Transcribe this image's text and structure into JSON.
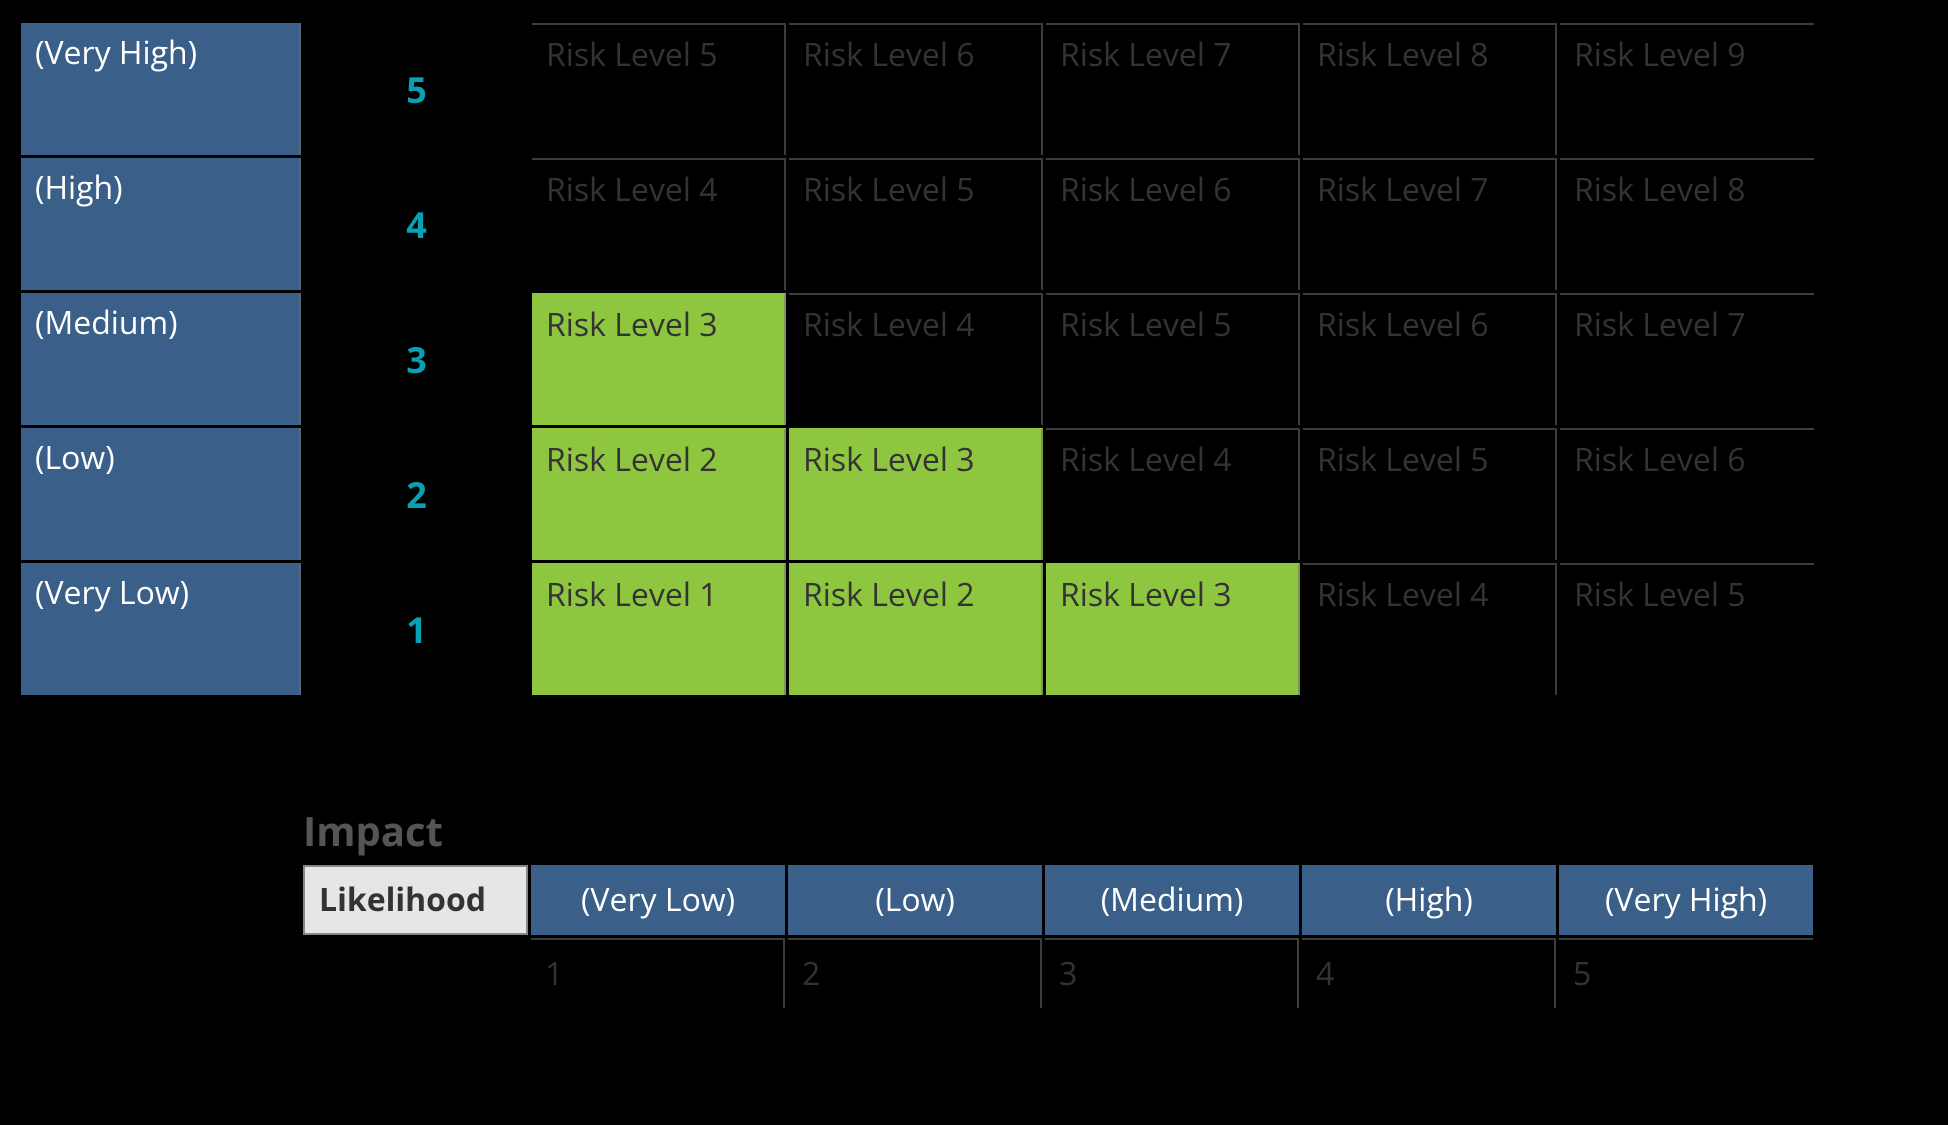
{
  "chart_data": {
    "type": "heatmap",
    "title": "",
    "row_axis": "Likelihood",
    "col_axis": "Impact",
    "rows": [
      {
        "label": "(Very High)",
        "value": 5
      },
      {
        "label": "(High)",
        "value": 4
      },
      {
        "label": "(Medium)",
        "value": 3
      },
      {
        "label": "(Low)",
        "value": 2
      },
      {
        "label": "(Very Low)",
        "value": 1
      }
    ],
    "columns": [
      {
        "label": "(Very Low)",
        "value": 1
      },
      {
        "label": "(Low)",
        "value": 2
      },
      {
        "label": "(Medium)",
        "value": 3
      },
      {
        "label": "(High)",
        "value": 4
      },
      {
        "label": "(Very High)",
        "value": 5
      }
    ],
    "cells": [
      [
        {
          "text": "Risk Level 5",
          "level": 5,
          "highlight": false
        },
        {
          "text": "Risk Level 6",
          "level": 6,
          "highlight": false
        },
        {
          "text": "Risk Level 7",
          "level": 7,
          "highlight": false
        },
        {
          "text": "Risk Level 8",
          "level": 8,
          "highlight": false
        },
        {
          "text": "Risk Level 9",
          "level": 9,
          "highlight": false
        }
      ],
      [
        {
          "text": "Risk Level 4",
          "level": 4,
          "highlight": false
        },
        {
          "text": "Risk Level 5",
          "level": 5,
          "highlight": false
        },
        {
          "text": "Risk Level 6",
          "level": 6,
          "highlight": false
        },
        {
          "text": "Risk Level 7",
          "level": 7,
          "highlight": false
        },
        {
          "text": "Risk Level 8",
          "level": 8,
          "highlight": false
        }
      ],
      [
        {
          "text": "Risk Level 3",
          "level": 3,
          "highlight": true
        },
        {
          "text": "Risk Level 4",
          "level": 4,
          "highlight": false
        },
        {
          "text": "Risk Level 5",
          "level": 5,
          "highlight": false
        },
        {
          "text": "Risk Level 6",
          "level": 6,
          "highlight": false
        },
        {
          "text": "Risk Level 7",
          "level": 7,
          "highlight": false
        }
      ],
      [
        {
          "text": "Risk Level 2",
          "level": 2,
          "highlight": true
        },
        {
          "text": "Risk Level 3",
          "level": 3,
          "highlight": true
        },
        {
          "text": "Risk Level 4",
          "level": 4,
          "highlight": false
        },
        {
          "text": "Risk Level 5",
          "level": 5,
          "highlight": false
        },
        {
          "text": "Risk Level 6",
          "level": 6,
          "highlight": false
        }
      ],
      [
        {
          "text": "Risk Level 1",
          "level": 1,
          "highlight": true
        },
        {
          "text": "Risk Level 2",
          "level": 2,
          "highlight": true
        },
        {
          "text": "Risk Level 3",
          "level": 3,
          "highlight": true
        },
        {
          "text": "Risk Level 4",
          "level": 4,
          "highlight": false
        },
        {
          "text": "Risk Level 5",
          "level": 5,
          "highlight": false
        }
      ]
    ]
  },
  "legend": {
    "impact_title": "Impact",
    "likelihood_header": "Likelihood"
  }
}
